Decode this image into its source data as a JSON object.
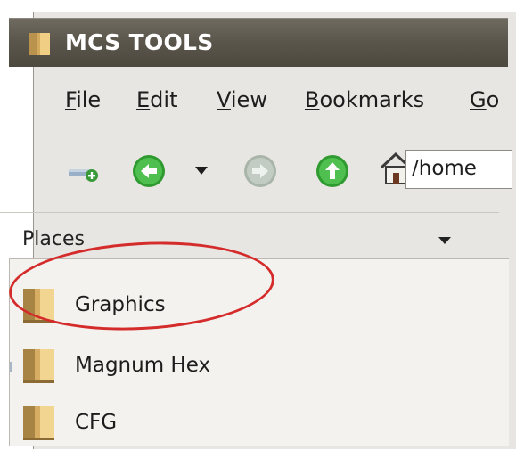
{
  "window": {
    "title": "MCS TOOLS",
    "title_icon": "folder-icon"
  },
  "menubar": {
    "items": [
      {
        "mnemonic": "F",
        "rest": "ile"
      },
      {
        "mnemonic": "E",
        "rest": "dit"
      },
      {
        "mnemonic": "V",
        "rest": "iew"
      },
      {
        "mnemonic": "B",
        "rest": "ookmarks"
      },
      {
        "mnemonic": "G",
        "rest": "o"
      }
    ]
  },
  "toolbar": {
    "buttons": [
      "new-folder-icon",
      "back-icon",
      "back-history-dropdown-icon",
      "forward-icon",
      "up-icon",
      "home-icon"
    ],
    "location": "/home"
  },
  "sidebar": {
    "header": "Places",
    "items": [
      {
        "label": "Graphics",
        "icon": "folder-icon"
      },
      {
        "label": "Magnum Hex",
        "icon": "folder-icon"
      },
      {
        "label": "CFG",
        "icon": "folder-icon"
      }
    ]
  },
  "colors": {
    "titlebar": "#5a554b",
    "nav_green": "#3aa33a",
    "annotation": "#d42b2b"
  }
}
